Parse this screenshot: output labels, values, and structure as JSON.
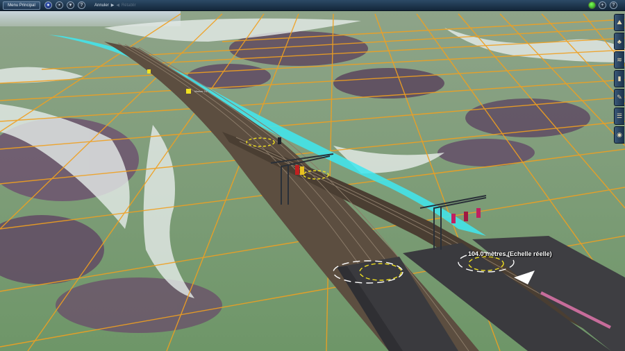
{
  "toolbar": {
    "main_menu_label": "Menu Principal",
    "undo_label": "Annuler",
    "redo_label": "Rétablir"
  },
  "right_tools": [
    {
      "name": "terrain-tool-icon"
    },
    {
      "name": "scenery-tool-icon"
    },
    {
      "name": "track-tool-icon"
    },
    {
      "name": "trackside-tool-icon"
    },
    {
      "name": "topology-tool-icon"
    },
    {
      "name": "layers-tool-icon"
    },
    {
      "name": "settings-tool-icon"
    }
  ],
  "scene": {
    "measurement_text": "104.0 mètres  (Echelle réelle)",
    "marker_labels": [
      "Marker 247"
    ]
  },
  "colors": {
    "toolbar_bg": "#1d3550",
    "grid_line": "#f0a020",
    "water": "#40e8f0",
    "status_ok": "#3ad020"
  }
}
